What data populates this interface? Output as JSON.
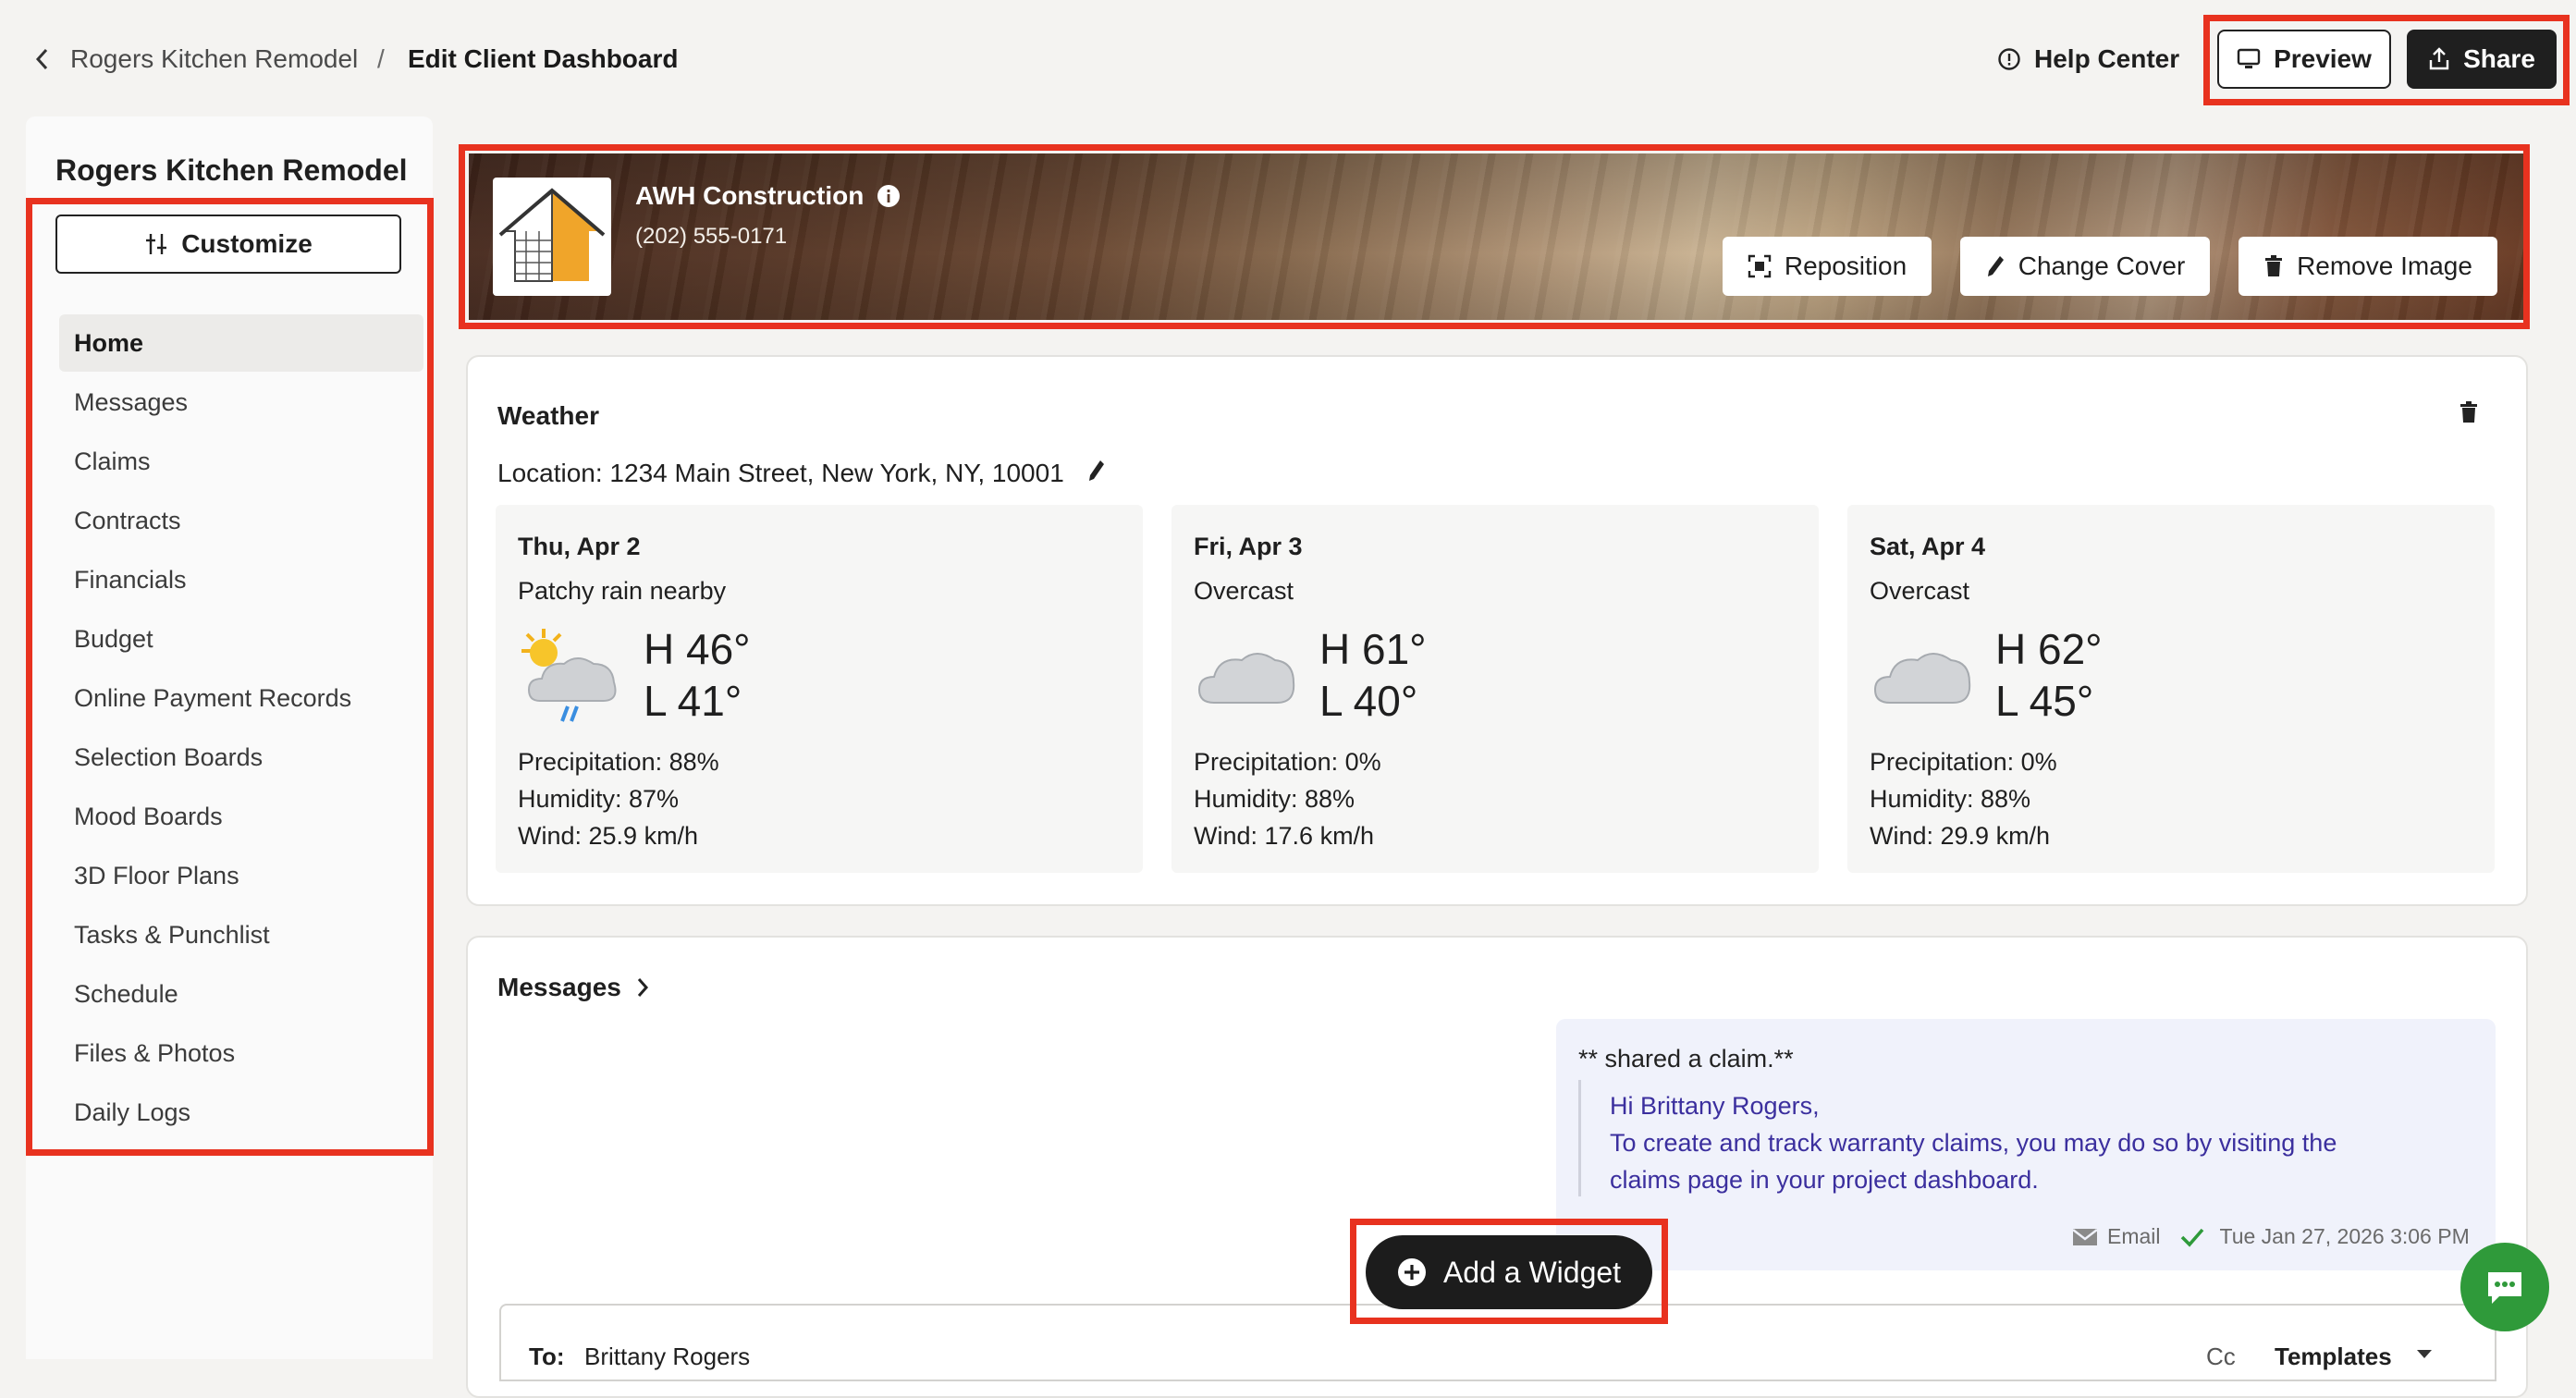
{
  "breadcrumb": {
    "parent": "Rogers Kitchen Remodel",
    "separator": "/",
    "current": "Edit Client Dashboard"
  },
  "topbar": {
    "help_label": "Help Center",
    "preview_label": "Preview",
    "share_label": "Share"
  },
  "sidebar": {
    "title": "Rogers Kitchen Remodel",
    "customize_label": "Customize",
    "items": [
      {
        "label": "Home",
        "active": true
      },
      {
        "label": "Messages"
      },
      {
        "label": "Claims"
      },
      {
        "label": "Contracts"
      },
      {
        "label": "Financials"
      },
      {
        "label": "Budget"
      },
      {
        "label": "Online Payment Records"
      },
      {
        "label": "Selection Boards"
      },
      {
        "label": "Mood Boards"
      },
      {
        "label": "3D Floor Plans"
      },
      {
        "label": "Tasks & Punchlist"
      },
      {
        "label": "Schedule"
      },
      {
        "label": "Files & Photos"
      },
      {
        "label": "Daily Logs"
      }
    ]
  },
  "banner": {
    "company": "AWH Construction",
    "phone": "(202) 555-0171",
    "reposition_label": "Reposition",
    "change_cover_label": "Change Cover",
    "remove_image_label": "Remove Image"
  },
  "weather": {
    "title": "Weather",
    "location": "Location: 1234 Main Street, New York, NY, 10001",
    "days": [
      {
        "date": "Thu, Apr 2",
        "condition": "Patchy rain nearby",
        "icon": "rain-cloud-sun-icon",
        "high": "H 46°",
        "low": "L 41°",
        "precip": "Precipitation: 88%",
        "humidity": "Humidity: 87%",
        "wind": "Wind: 25.9 km/h"
      },
      {
        "date": "Fri, Apr 3",
        "condition": "Overcast",
        "icon": "cloud-icon",
        "high": "H 61°",
        "low": "L 40°",
        "precip": "Precipitation: 0%",
        "humidity": "Humidity: 88%",
        "wind": "Wind: 17.6 km/h"
      },
      {
        "date": "Sat, Apr 4",
        "condition": "Overcast",
        "icon": "cloud-icon",
        "high": "H 62°",
        "low": "L 45°",
        "precip": "Precipitation: 0%",
        "humidity": "Humidity: 88%",
        "wind": "Wind: 29.9 km/h"
      }
    ]
  },
  "messages": {
    "title": "Messages",
    "message": {
      "header": "** shared a claim.**",
      "greeting": "Hi Brittany Rogers,",
      "body_line1": "To create and track warranty claims, you may do so by visiting the",
      "body_line2": "claims page in your project dashboard.",
      "channel": "Email",
      "timestamp": "Tue Jan 27, 2026 3:06 PM"
    },
    "compose": {
      "to_label": "To:",
      "to_value": "Brittany Rogers",
      "cc_label": "Cc",
      "templates_label": "Templates"
    }
  },
  "fab": {
    "label": "Add a Widget"
  },
  "colors": {
    "highlight": "#e8321f",
    "accent_dark": "#1f1f1f",
    "chat_green": "#2f9a3a",
    "message_text": "#3b2f9e"
  }
}
